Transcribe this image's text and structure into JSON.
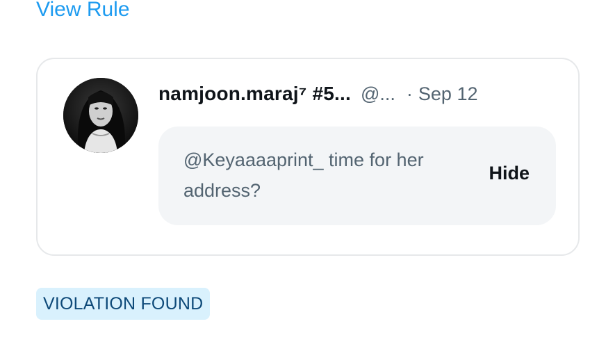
{
  "view_rule": {
    "label": "View Rule"
  },
  "tweet": {
    "display_name": "namjoon.maraj⁷ #5...",
    "handle": "@...",
    "separator": "·",
    "date": "Sep 12",
    "reply": {
      "text": "@Keyaaaaprint_ time for her address?",
      "hide_label": "Hide"
    },
    "avatar_icon": "profile-photo"
  },
  "status": {
    "badge_label": "VIOLATION FOUND"
  },
  "colors": {
    "link": "#1d9bf0",
    "primary_text": "#0f1419",
    "secondary_text": "#536471",
    "card_border": "#e6e8ea",
    "reply_background": "#f3f5f7",
    "badge_background": "#d9f1fd",
    "badge_text": "#0e4a79"
  }
}
